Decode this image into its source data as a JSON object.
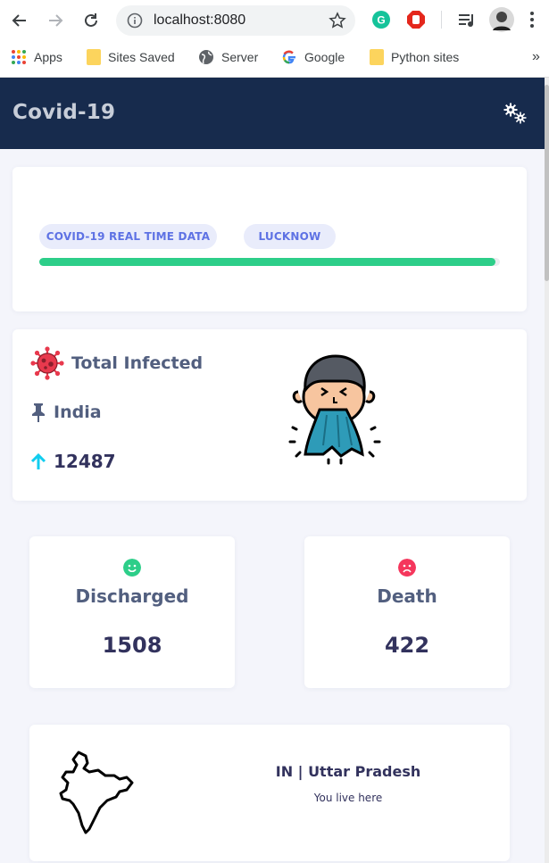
{
  "browser": {
    "url": "localhost:8080",
    "bookmarks": [
      {
        "label": "Apps"
      },
      {
        "label": "Sites Saved"
      },
      {
        "label": "Server"
      },
      {
        "label": "Google"
      },
      {
        "label": "Python sites"
      }
    ],
    "more_glyph": "»"
  },
  "app": {
    "title": "Covid-19",
    "settings_icon": "gears-icon"
  },
  "status_card": {
    "badges": [
      "COVID-19 REAL TIME DATA",
      "LUCKNOW"
    ],
    "progress": 0.99,
    "progress_color": "#2dce89"
  },
  "summary": {
    "label": "Total Infected",
    "country": "India",
    "count": "12487",
    "virus_color": "#e8394d",
    "arrow_color": "#11cdef"
  },
  "stats": {
    "discharged": {
      "label": "Discharged",
      "value": "1508",
      "color": "#2dce89"
    },
    "death": {
      "label": "Death",
      "value": "422",
      "color": "#f5365c"
    }
  },
  "location": {
    "title": "IN | Uttar Pradesh",
    "subtitle": "You live here"
  }
}
